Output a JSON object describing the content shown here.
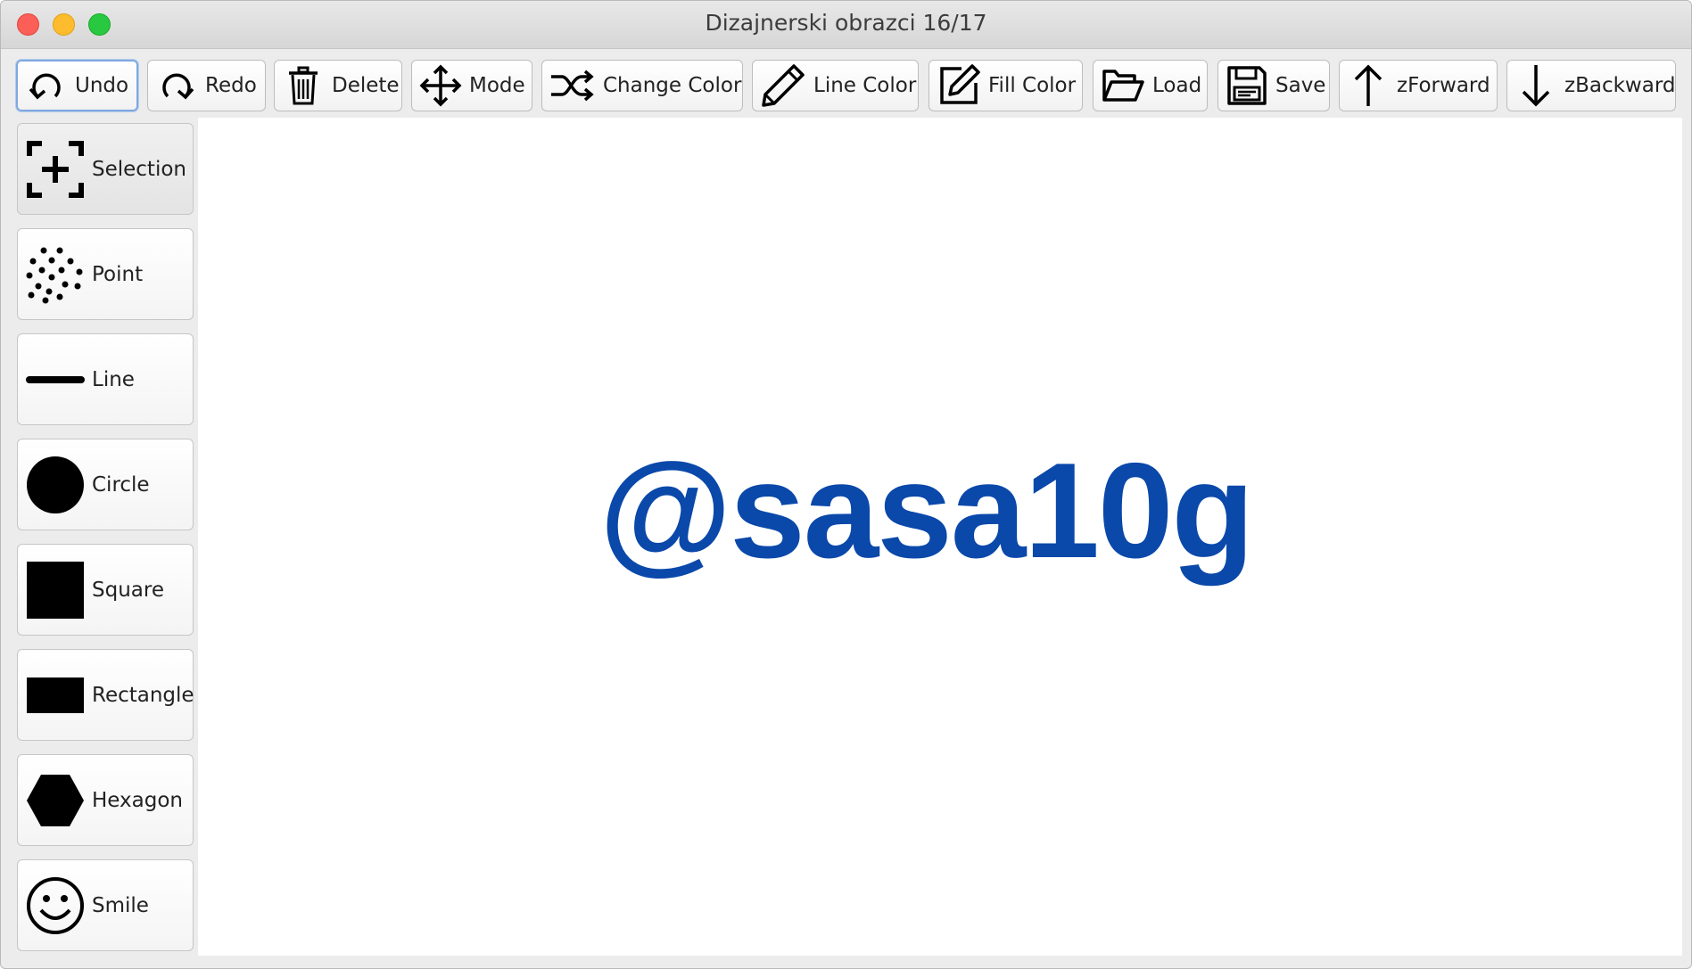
{
  "window": {
    "title": "Dizajnerski obrazci 16/17"
  },
  "toolbar": {
    "items": [
      {
        "label": "Undo",
        "icon": "undo-icon"
      },
      {
        "label": "Redo",
        "icon": "redo-icon"
      },
      {
        "label": "Delete",
        "icon": "trash-icon"
      },
      {
        "label": "Mode",
        "icon": "move-icon"
      },
      {
        "label": "Change Color",
        "icon": "shuffle-icon"
      },
      {
        "label": "Line Color",
        "icon": "pencil-icon"
      },
      {
        "label": "Fill Color",
        "icon": "edit-square-icon"
      },
      {
        "label": "Load",
        "icon": "folder-open-icon"
      },
      {
        "label": "Save",
        "icon": "floppy-disk-icon"
      },
      {
        "label": "zForward",
        "icon": "arrow-up-icon"
      },
      {
        "label": "zBackward",
        "icon": "arrow-down-icon"
      }
    ]
  },
  "sidebar": {
    "items": [
      {
        "label": "Selection",
        "icon": "selection-icon"
      },
      {
        "label": "Point",
        "icon": "dots-icon"
      },
      {
        "label": "Line",
        "icon": "line-icon"
      },
      {
        "label": "Circle",
        "icon": "circle-icon"
      },
      {
        "label": "Square",
        "icon": "square-icon"
      },
      {
        "label": "Rectangle",
        "icon": "rectangle-icon"
      },
      {
        "label": "Hexagon",
        "icon": "hexagon-icon"
      },
      {
        "label": "Smile",
        "icon": "smile-icon"
      }
    ]
  },
  "canvas": {
    "watermark": "@sasa10g",
    "watermark_color": "#0a48aa"
  }
}
